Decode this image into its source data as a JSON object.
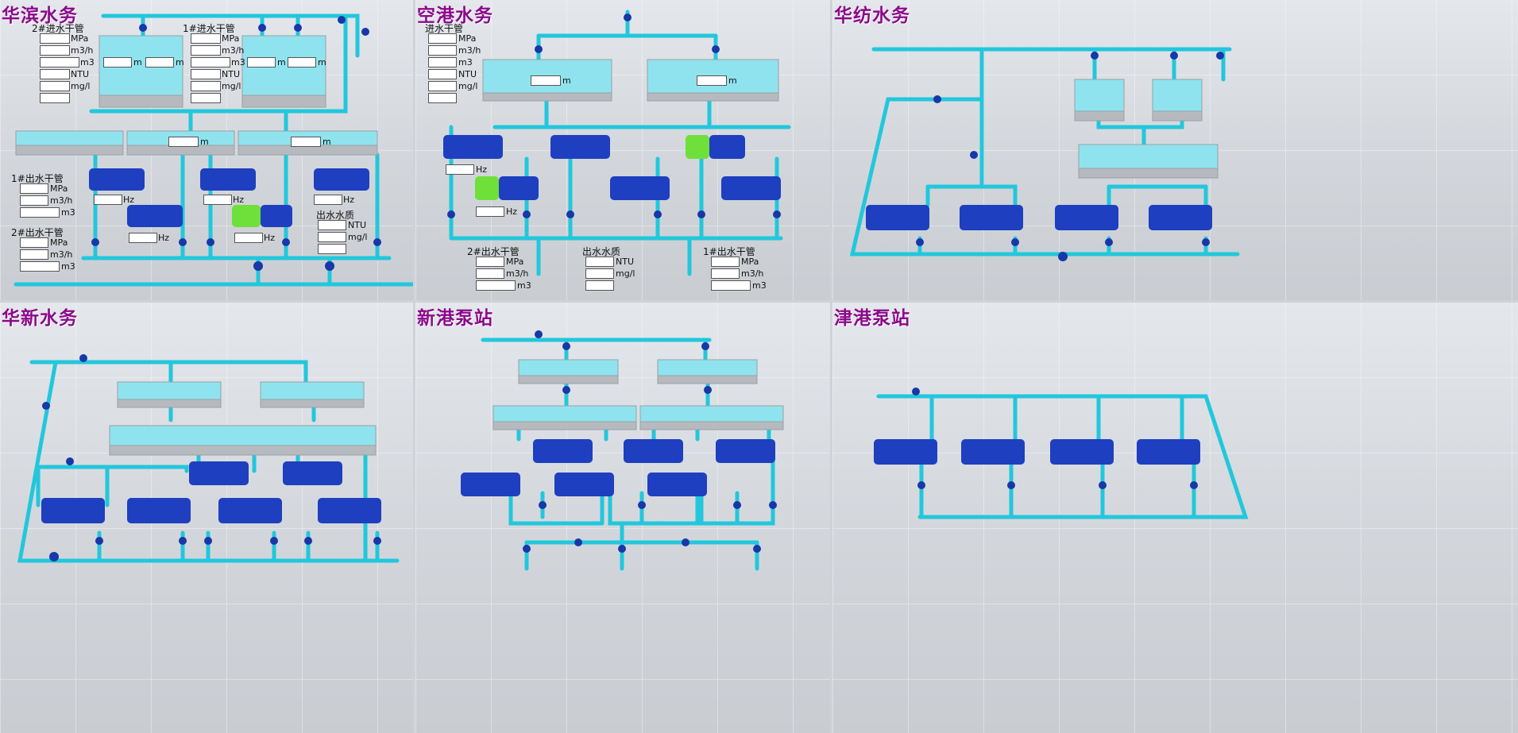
{
  "panels": [
    {
      "title": "华滨水务"
    },
    {
      "title": "空港水务"
    },
    {
      "title": "华纺水务"
    },
    {
      "title": "华新水务"
    },
    {
      "title": "新港泵站"
    },
    {
      "title": "津港泵站"
    }
  ],
  "units": {
    "mpa": "MPa",
    "flow": "m3/h",
    "vol": "m3",
    "ntu": "NTU",
    "mgl": "mg/l",
    "m": "m",
    "hz": "Hz"
  },
  "huabin": {
    "inlet2": "2#进水干管",
    "inlet1": "1#进水干管",
    "outlet1": "1#出水干管",
    "outlet2": "2#出水干管",
    "quality": "出水水质"
  },
  "konggang": {
    "inlet": "进水干管",
    "outlet2": "2#出水干管",
    "quality": "出水水质",
    "outlet1": "1#出水干管"
  },
  "colors": {
    "title": "#8b0a8b",
    "pipe": "#22c7dc",
    "pump": "#1e3fbf",
    "pump_running": "#6fe03a"
  }
}
